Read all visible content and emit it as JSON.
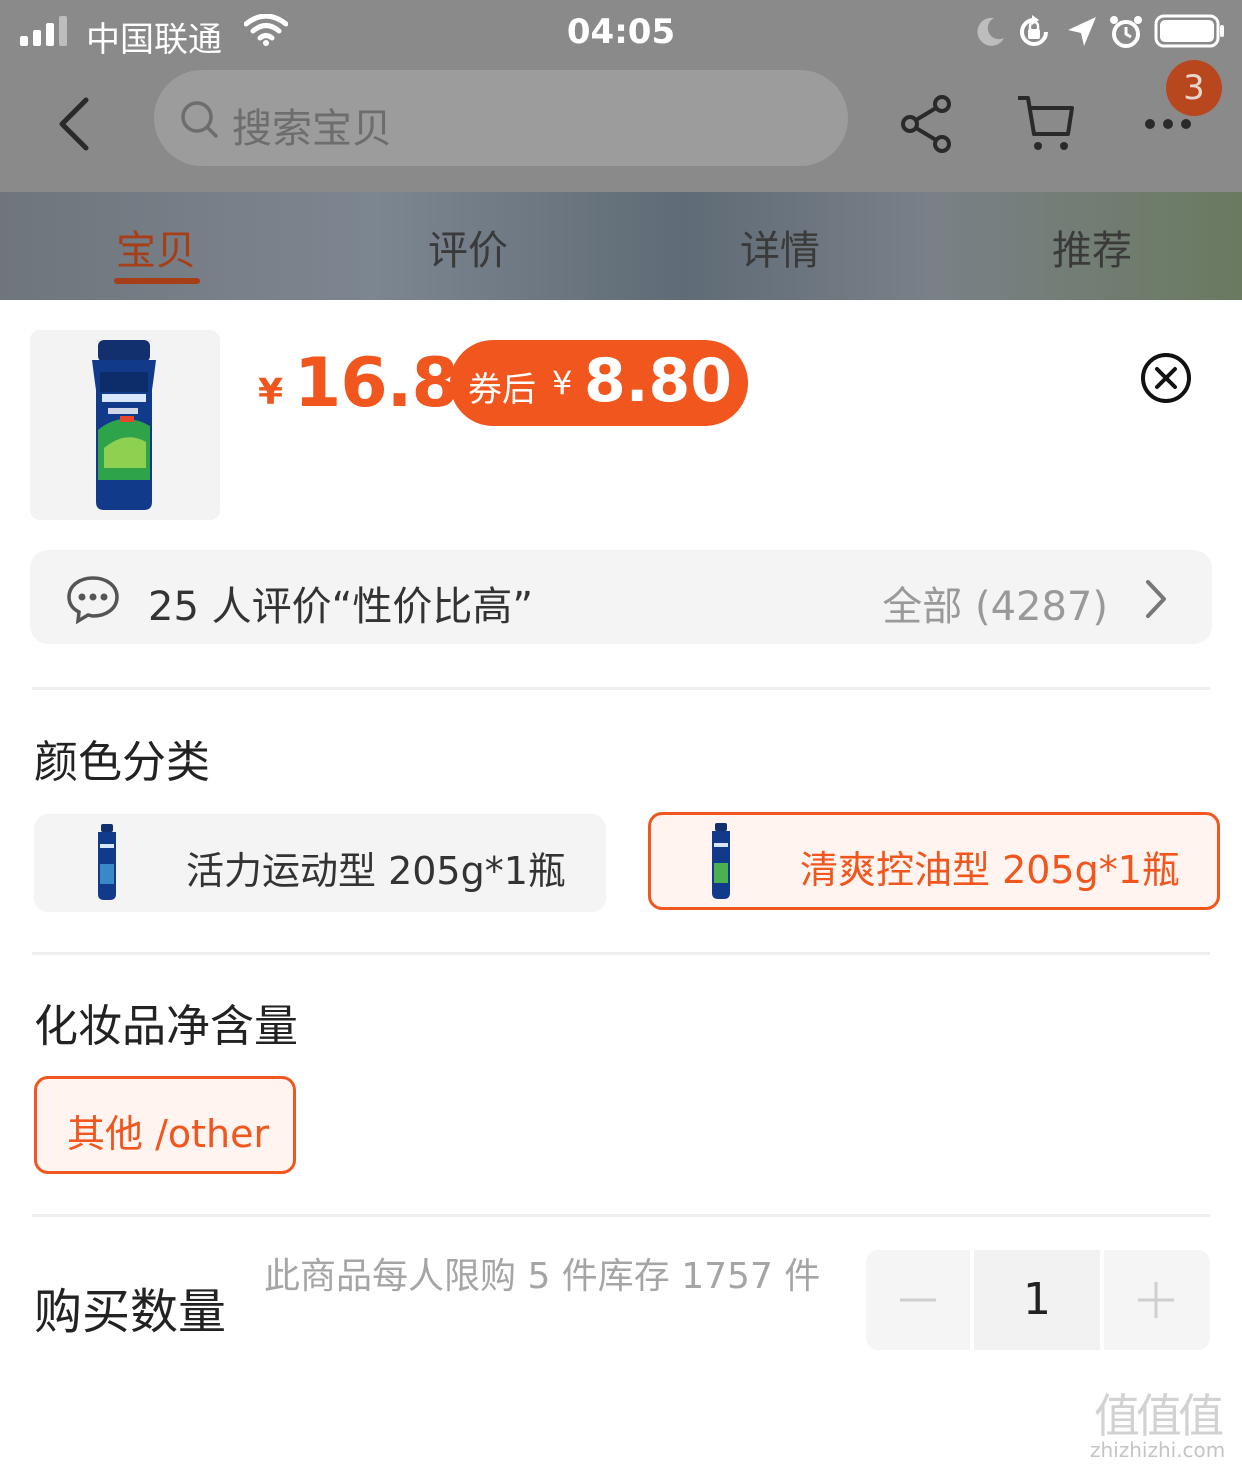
{
  "status_bar": {
    "carrier": "中国联通",
    "time": "04:05"
  },
  "nav": {
    "search_placeholder": "搜索宝贝",
    "cart_badge": "3"
  },
  "tabs": [
    {
      "label": "宝贝",
      "active": true
    },
    {
      "label": "评价",
      "active": false
    },
    {
      "label": "详情",
      "active": false
    },
    {
      "label": "推荐",
      "active": false
    }
  ],
  "sku_sheet": {
    "price": {
      "currency": "¥",
      "amount": "16.8"
    },
    "coupon": {
      "label": "券后",
      "currency": "¥",
      "amount": "8.80"
    },
    "review": {
      "text": "25 人评价“性价比高”",
      "all_label": "全部 (4287)"
    },
    "color_section": {
      "title": "颜色分类",
      "options": [
        {
          "label": "活力运动型 205g*1瓶",
          "selected": false
        },
        {
          "label": "清爽控油型 205g*1瓶",
          "selected": true
        }
      ]
    },
    "size_section": {
      "title": "化妆品净含量",
      "options": [
        {
          "label": "其他 /other",
          "selected": true
        }
      ]
    },
    "quantity": {
      "title": "购买数量",
      "hint": "此商品每人限购 5 件库存 1757 件",
      "value": "1"
    }
  },
  "watermark": {
    "glyphs": "值值值",
    "text": "zhizhizhi.com"
  },
  "colors": {
    "accent": "#f0561d",
    "overlay": "#8a8a8a",
    "muted_text": "#a5a5a5"
  },
  "icons": [
    "signal-icon",
    "wifi-icon",
    "moon-icon",
    "rotation-lock-icon",
    "location-icon",
    "alarm-icon",
    "battery-icon",
    "back-icon",
    "search-icon",
    "share-icon",
    "cart-icon",
    "more-icon",
    "close-icon",
    "chat-bubble-icon",
    "chevron-right-icon",
    "minus-icon",
    "plus-icon"
  ]
}
